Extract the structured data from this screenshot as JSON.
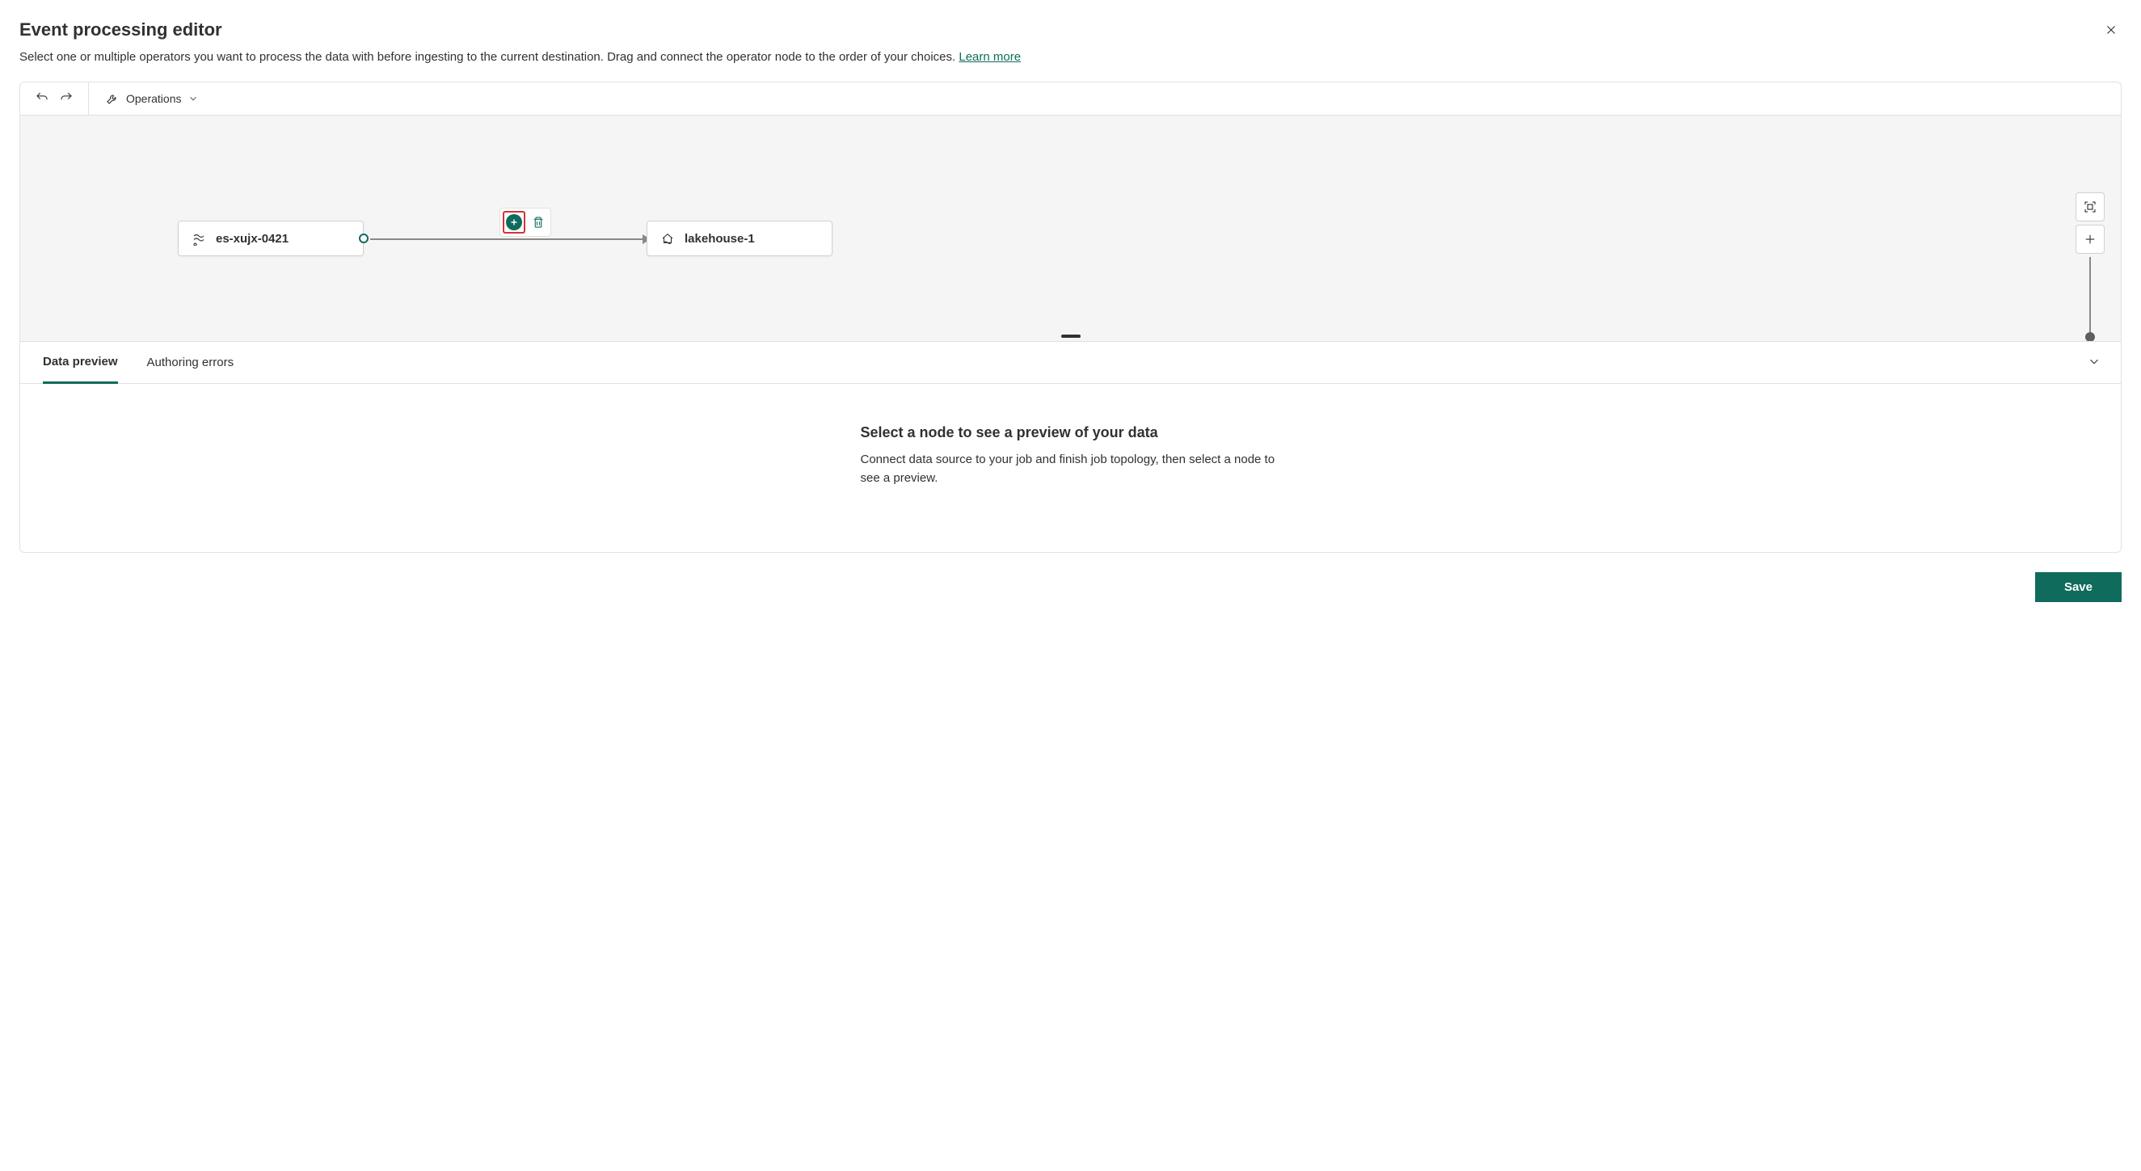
{
  "header": {
    "title": "Event processing editor",
    "subtitle": "Select one or multiple operators you want to process the data with before ingesting to the current destination. Drag and connect the operator node to the order of your choices.",
    "learn_more": "Learn more"
  },
  "toolbar": {
    "operations_label": "Operations"
  },
  "nodes": {
    "source": {
      "label": "es-xujx-0421"
    },
    "destination": {
      "label": "lakehouse-1"
    }
  },
  "tabs": {
    "data_preview": "Data preview",
    "authoring_errors": "Authoring errors"
  },
  "panel": {
    "empty_title": "Select a node to see a preview of your data",
    "empty_desc": "Connect data source to your job and finish job topology, then select a node to see a preview."
  },
  "footer": {
    "save_label": "Save"
  }
}
